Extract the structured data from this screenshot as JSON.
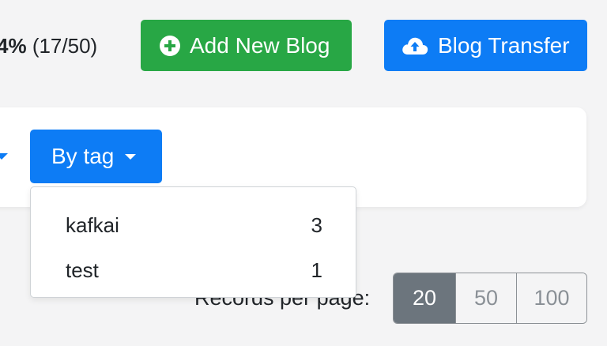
{
  "header": {
    "usage_percent": "4%",
    "usage_count": "(17/50)",
    "add_blog_label": "Add New Blog",
    "transfer_label": "Blog Transfer"
  },
  "filters": {
    "tag_button_label": "By tag",
    "tag_options": [
      {
        "name": "kafkai",
        "count": "3"
      },
      {
        "name": "test",
        "count": "1"
      }
    ]
  },
  "pagination": {
    "records_label": "Records per page:",
    "options": [
      "20",
      "50",
      "100"
    ],
    "selected": "20"
  },
  "colors": {
    "green": "#28a745",
    "blue": "#0d7cf5",
    "gray_active": "#6c757d"
  },
  "icons": {
    "add": "plus-circle-icon",
    "transfer": "cloud-upload-icon",
    "dropdown": "caret-down-icon"
  }
}
